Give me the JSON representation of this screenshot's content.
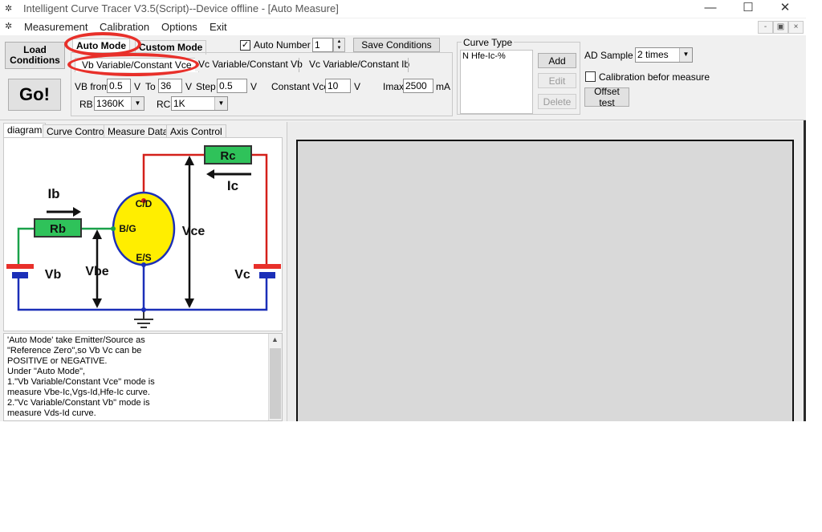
{
  "window": {
    "title": "Intelligent Curve Tracer V3.5(Script)--Device offline - [Auto Measure]",
    "minimize_glyph": "—",
    "maximize_glyph": "☐",
    "close_glyph": "✕",
    "app_icon": "curve-tracer-app-icon"
  },
  "menubar": {
    "items": [
      "Measurement",
      "Calibration",
      "Options",
      "Exit"
    ],
    "mdi_buttons": [
      "-",
      "▣",
      "×"
    ]
  },
  "toolbar": {
    "load_conditions": "Load\nConditions",
    "load_line1": "Load",
    "load_line2": "Conditions",
    "go": "Go!",
    "mode_tabs": [
      "Auto Mode",
      "Custom Mode"
    ],
    "auto_number_label": "Auto Number",
    "auto_number_checked": true,
    "auto_number_value": "1",
    "save_conditions": "Save Conditions",
    "sub_tabs": [
      "Vb Variable/Constant Vce",
      "Vc Variable/Constant Vb",
      "Vc Variable/Constant Ib"
    ],
    "vb_from_label": "VB from",
    "vb_from_value": "0.5",
    "unit_v": "V",
    "to_label": "To",
    "to_value": "36",
    "step_label": "Step",
    "step_value": "0.5",
    "constant_vce_label": "Constant Vce",
    "constant_vce_value": "10",
    "imax_label": "Imax",
    "imax_value": "2500",
    "imax_unit": "mA",
    "rb_label": "RB",
    "rb_value": "1360K",
    "rc_label": "RC",
    "rc_value": "1K"
  },
  "curve_type": {
    "title": "Curve Type",
    "items": [
      "N Hfe-Ic-%"
    ],
    "add": "Add",
    "edit": "Edit",
    "delete": "Delete"
  },
  "ad": {
    "sample_label": "AD Sample",
    "sample_value": "2 times",
    "calibration_label": "Calibration befor measure",
    "calibration_checked": false,
    "offset_test": "Offset test"
  },
  "left_tabs": [
    "diagram",
    "Curve Control",
    "Measure Data",
    "Axis Control"
  ],
  "diagram": {
    "rc": "Rc",
    "ic": "Ic",
    "ib": "Ib",
    "rb": "Rb",
    "cd": "C/D",
    "bg": "B/G",
    "es": "E/S",
    "vce": "Vce",
    "vbe": "Vbe",
    "vb": "Vb",
    "vc": "Vc"
  },
  "help_text": [
    "  'Auto Mode' take Emitter/Source as",
    "\"Reference Zero\",so Vb Vc can be",
    "POSITIVE or NEGATIVE.",
    "  Under \"Auto Mode\",",
    "1.\"Vb Variable/Constant Vce\" mode is",
    "measure Vbe-Ic,Vgs-Id,Hfe-Ic curve.",
    "2.\"Vc Variable/Constant Vb\" mode is",
    "measure Vds-Id curve."
  ],
  "colors": {
    "highlight": "#e8302a",
    "wire_red": "#d4201a",
    "wire_green": "#1aa14a",
    "wire_blue": "#1b2fb8",
    "resistor": "#2fc25a",
    "transistor": "#ffee00",
    "plot_bg": "#d9d9d9"
  }
}
